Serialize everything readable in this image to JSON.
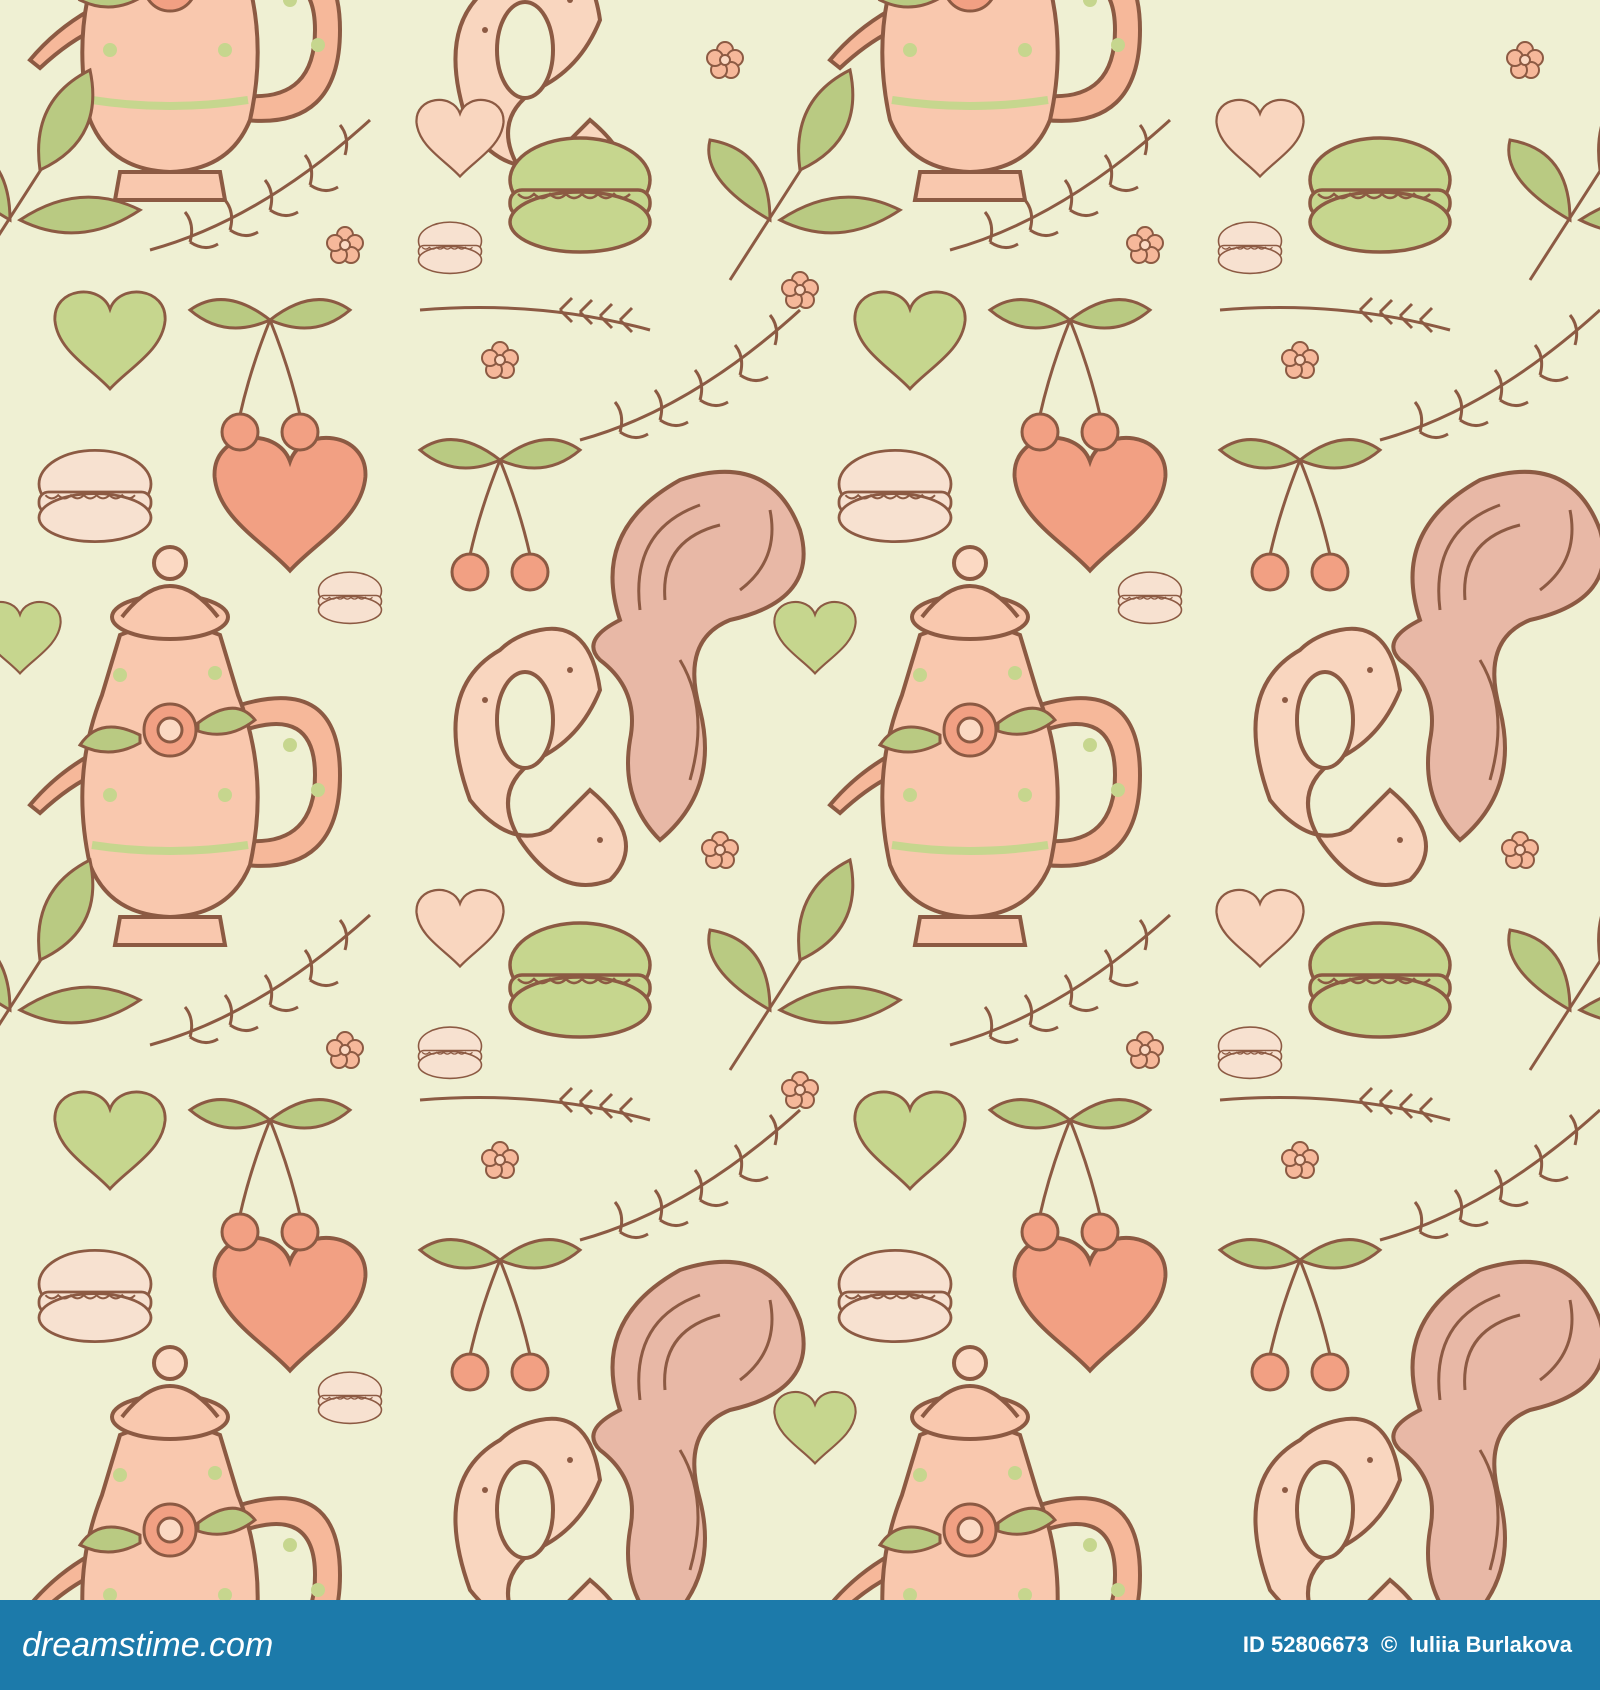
{
  "image": {
    "subject": "seamless-tea-party-pattern",
    "colors": {
      "background": "#EFF0D3",
      "outline": "#8C5A43",
      "peach": "#F6B89A",
      "light_peach": "#FBD9C3",
      "salmon": "#F2A083",
      "green": "#C6D68E",
      "leaf_green": "#B9CA82",
      "macaron_cream": "#F7E1D0",
      "footer": "#1C7AAA"
    }
  },
  "footer": {
    "logo_text": "dreamstime.com",
    "id_label": "ID 52806673",
    "copyright_symbol": "©",
    "author": "Iuliia Burlakova"
  }
}
